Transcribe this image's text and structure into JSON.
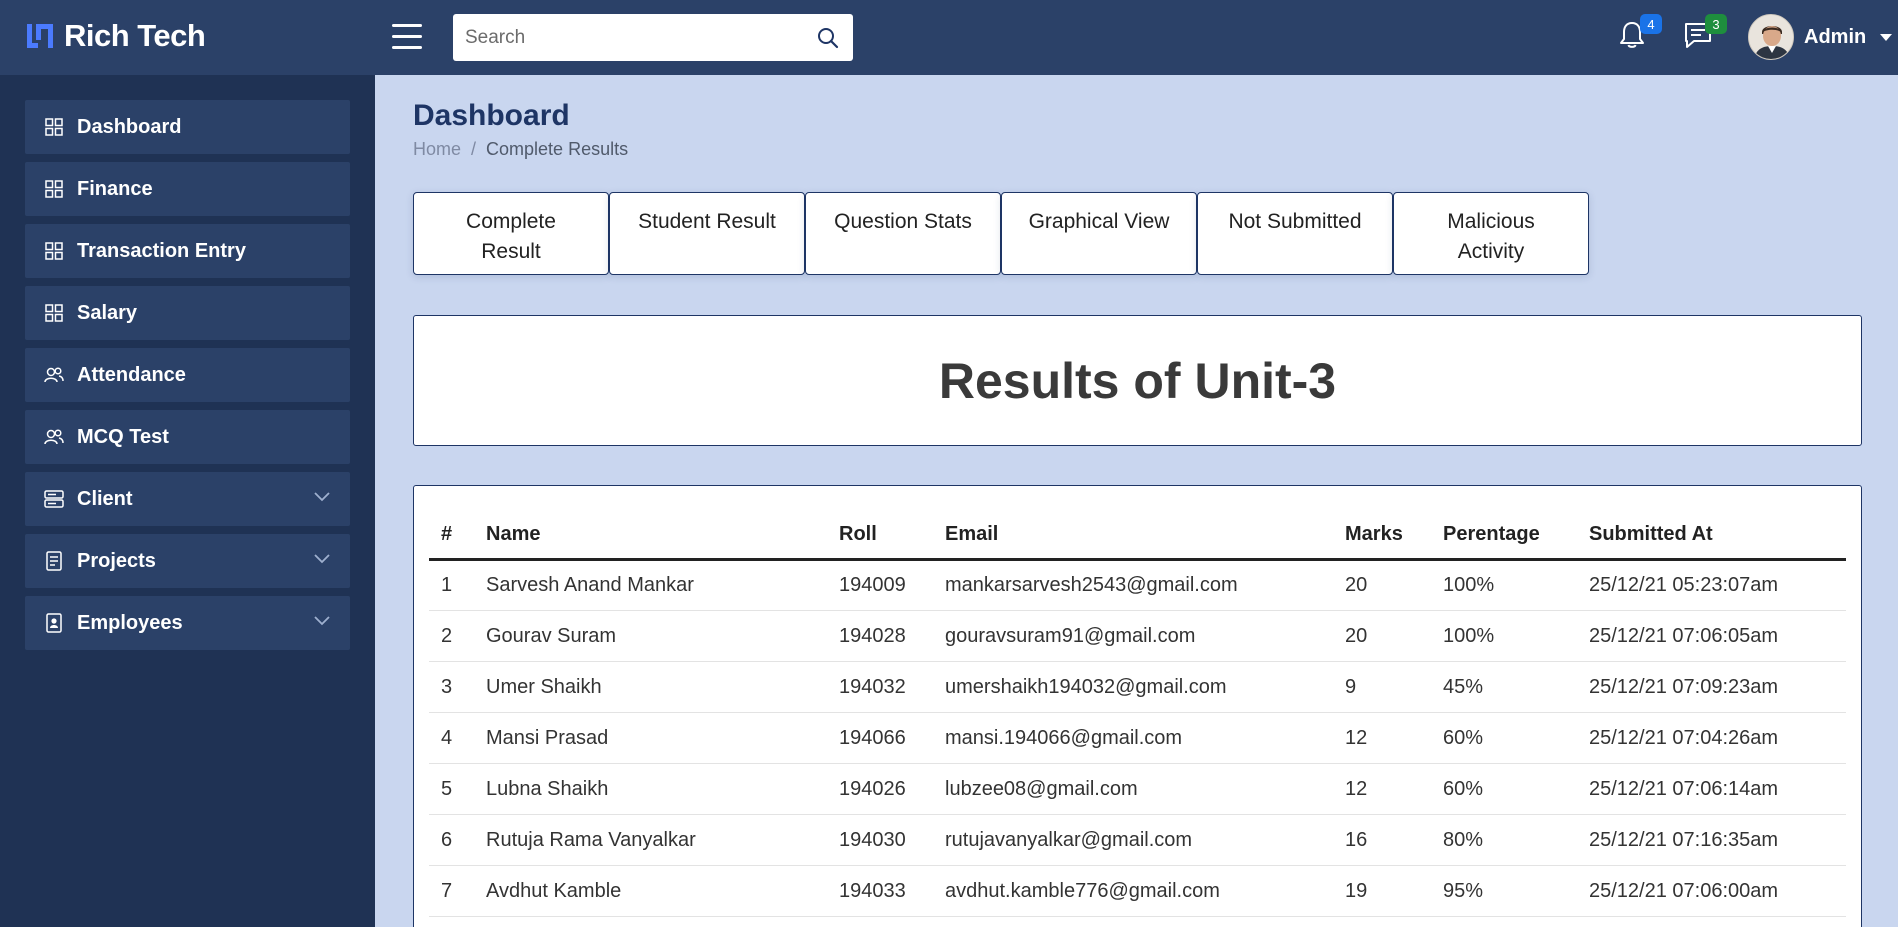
{
  "brand": {
    "name": "Rich Tech"
  },
  "search": {
    "placeholder": "Search"
  },
  "notifications": {
    "count": "4",
    "badge_color": "#1a73e8"
  },
  "messages": {
    "count": "3",
    "badge_color": "#1e8e3e"
  },
  "user": {
    "name": "Admin"
  },
  "sidebar": {
    "items": [
      {
        "label": "Dashboard",
        "icon": "grid-icon"
      },
      {
        "label": "Finance",
        "icon": "grid-icon"
      },
      {
        "label": "Transaction Entry",
        "icon": "grid-icon"
      },
      {
        "label": "Salary",
        "icon": "grid-icon"
      },
      {
        "label": "Attendance",
        "icon": "people-icon"
      },
      {
        "label": "MCQ Test",
        "icon": "people-icon"
      },
      {
        "label": "Client",
        "icon": "server-icon",
        "expandable": true
      },
      {
        "label": "Projects",
        "icon": "document-icon",
        "expandable": true
      },
      {
        "label": "Employees",
        "icon": "id-badge-icon",
        "expandable": true
      }
    ]
  },
  "page": {
    "title": "Dashboard",
    "breadcrumb": {
      "home": "Home",
      "separator": "/",
      "current": "Complete Results"
    }
  },
  "tabs": [
    {
      "label": "Complete Result"
    },
    {
      "label": "Student Result"
    },
    {
      "label": "Question Stats"
    },
    {
      "label": "Graphical View"
    },
    {
      "label": "Not Submitted"
    },
    {
      "label": "Malicious Activity"
    }
  ],
  "results": {
    "title": "Results of Unit-3",
    "columns": [
      "#",
      "Name",
      "Roll",
      "Email",
      "Marks",
      "Perentage",
      "Submitted At"
    ],
    "rows": [
      [
        "1",
        "Sarvesh Anand Mankar",
        "194009",
        "mankarsarvesh2543@gmail.com",
        "20",
        "100%",
        "25/12/21 05:23:07am"
      ],
      [
        "2",
        "Gourav Suram",
        "194028",
        "gouravsuram91@gmail.com",
        "20",
        "100%",
        "25/12/21 07:06:05am"
      ],
      [
        "3",
        "Umer Shaikh",
        "194032",
        "umershaikh194032@gmail.com",
        "9",
        "45%",
        "25/12/21 07:09:23am"
      ],
      [
        "4",
        "Mansi Prasad",
        "194066",
        "mansi.194066@gmail.com",
        "12",
        "60%",
        "25/12/21 07:04:26am"
      ],
      [
        "5",
        "Lubna Shaikh",
        "194026",
        "lubzee08@gmail.com",
        "12",
        "60%",
        "25/12/21 07:06:14am"
      ],
      [
        "6",
        "Rutuja Rama Vanyalkar",
        "194030",
        "rutujavanyalkar@gmail.com",
        "16",
        "80%",
        "25/12/21 07:16:35am"
      ],
      [
        "7",
        "Avdhut Kamble",
        "194033",
        "avdhut.kamble776@gmail.com",
        "19",
        "95%",
        "25/12/21 07:06:00am"
      ]
    ]
  },
  "colors": {
    "header_bg": "#2b4168",
    "sidebar_bg": "#1f3254",
    "sidebar_item_bg": "#2b4168",
    "content_bg": "#c9d6ef",
    "accent": "#1e3565",
    "logo": "#4b7bff"
  }
}
